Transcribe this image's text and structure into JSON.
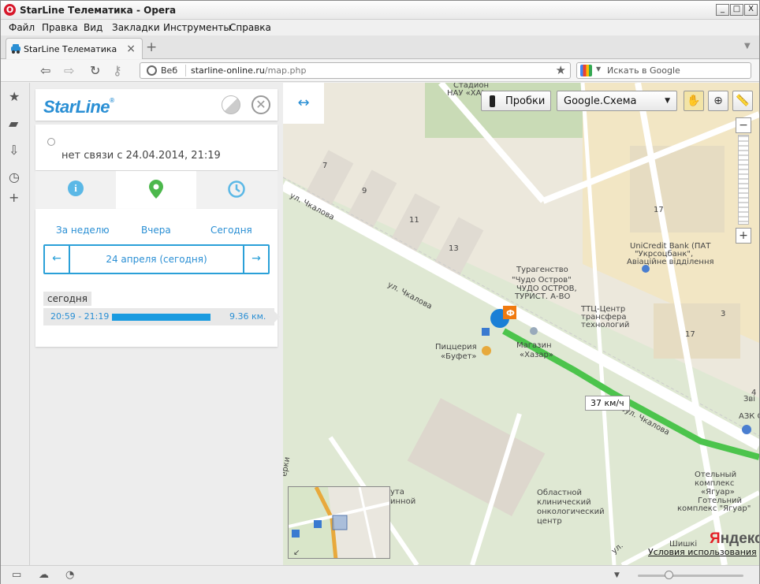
{
  "window": {
    "title": "StarLine Телематика - Opera",
    "min": "_",
    "max": "□",
    "close": "X"
  },
  "menu": [
    "Файл",
    "Правка",
    "Вид",
    "Закладки",
    "Инструменты",
    "Справка"
  ],
  "tab": {
    "label": "StarLine Телематика",
    "close": "×"
  },
  "newtab": "+",
  "address": {
    "prefix": "Веб",
    "domain": "starline-online.ru",
    "path": "/map.php"
  },
  "search": {
    "placeholder": "Искать в Google"
  },
  "panel": {
    "logo": "StarLine",
    "logo_reg": "®",
    "status": "нет связи с 24.04.2014, 21:19",
    "periods": [
      "За неделю",
      "Вчера",
      "Сегодня"
    ],
    "date": "24 апреля (сегодня)",
    "prev": "←",
    "next": "→",
    "day_label": "сегодня",
    "trip": {
      "time": "20:59 - 21:19",
      "distance": "9.36 км."
    }
  },
  "map": {
    "expand": "↔",
    "traffic_label": "Пробки",
    "map_type": "Google.Схема",
    "zoom_in": "+",
    "zoom_out": "−",
    "speed_label": "37 км/ч",
    "logo_y": "Я",
    "logo_rest": "ндекс",
    "terms": "Условия использования",
    "labels": {
      "street1": "ул. Чкалова",
      "street2": "ул. Чкалова",
      "street3": "вул. Чкалова",
      "stadium1": "Стадион",
      "stadium2": "НАУ «ХАІ»",
      "b7": "7",
      "b9": "9",
      "b11": "11",
      "b13": "13",
      "b17a": "17",
      "b17b": "17",
      "b3": "3",
      "b4": "4",
      "agency1": "Турагенство",
      "agency2": "\"Чудо Остров\"",
      "agency3": "ЧУДО ОСТРОВ,",
      "agency4": "ТУРИСТ. А-ВО",
      "bank1": "UniCredit Bank (ПАТ",
      "bank2": "\"Укрсоцбанк\",",
      "bank3": "Авіаційне відділення",
      "ttc1": "ТТЦ-Центр",
      "ttc2": "трансфера",
      "ttc3": "технологий",
      "pizza1": "Пиццерия",
      "pizza2": "«Буфет»",
      "shop1": "Магазин",
      "shop2": "«Хазар»",
      "azs": "АЗК О",
      "zv": "Зві",
      "hotel1": "Отельный",
      "hotel2": "комплекс",
      "hotel3": "«Ягуар»",
      "hotel4": "Готельний",
      "hotel5": "комплекс \"Ягуар\"",
      "hosp1": "Областной",
      "hosp2": "клинический",
      "hosp3": "онкологический",
      "hosp4": "центр",
      "uta": "ута",
      "ninnoy": "инной",
      "erki": "ерки",
      "shish": "Шишкі",
      "ul": "ул."
    }
  }
}
